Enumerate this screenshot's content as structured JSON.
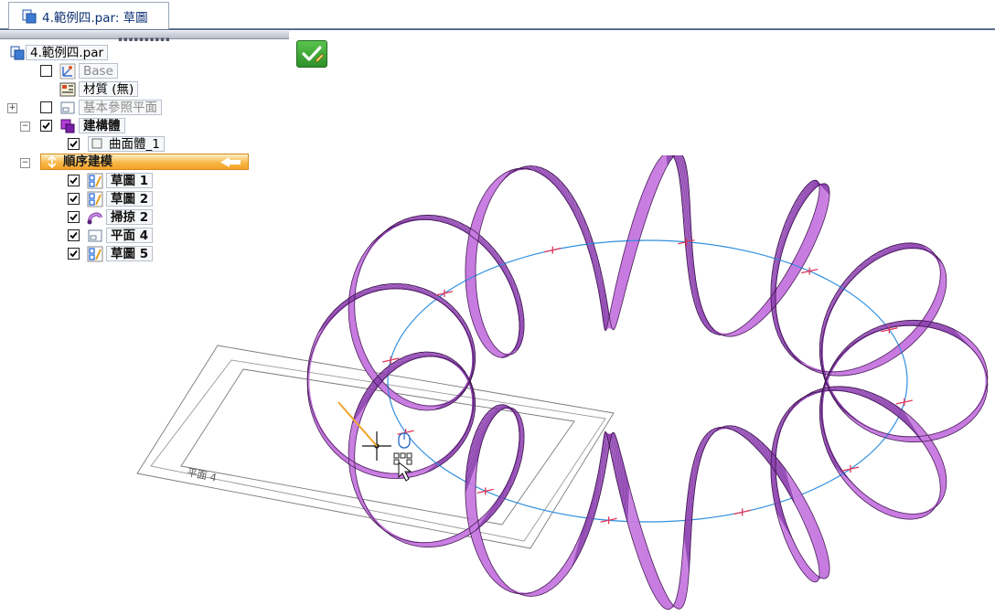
{
  "document_tab": {
    "label": "4.範例四.par: 草圖"
  },
  "tree": {
    "root": "4.範例四.par",
    "items": [
      {
        "label": "Base",
        "checked": false,
        "gray": true
      },
      {
        "label": "材質 (無)"
      },
      {
        "label": "基本參照平面",
        "checked": false,
        "gray": true,
        "expander": "+"
      },
      {
        "label": "建構體",
        "checked": true,
        "expander": "−"
      },
      {
        "label": "曲面體_1",
        "checked": true
      },
      {
        "label": "順序建模",
        "expander": "−"
      },
      {
        "label": "草圖 1",
        "checked": true
      },
      {
        "label": "草圖 2",
        "checked": true
      },
      {
        "label": "掃掠 2",
        "checked": true
      },
      {
        "label": "平面 4",
        "checked": true
      },
      {
        "label": "草圖 5",
        "checked": true
      }
    ]
  },
  "viewport": {
    "plane_label": "平面 4"
  },
  "colors": {
    "surface": "#c77ae0",
    "surface_dark": "#8b3fae",
    "path_circle": "#2f8fe0",
    "marker": "#e0365a",
    "tab_text": "#0b2f73",
    "highlight": "#f8b94a"
  }
}
